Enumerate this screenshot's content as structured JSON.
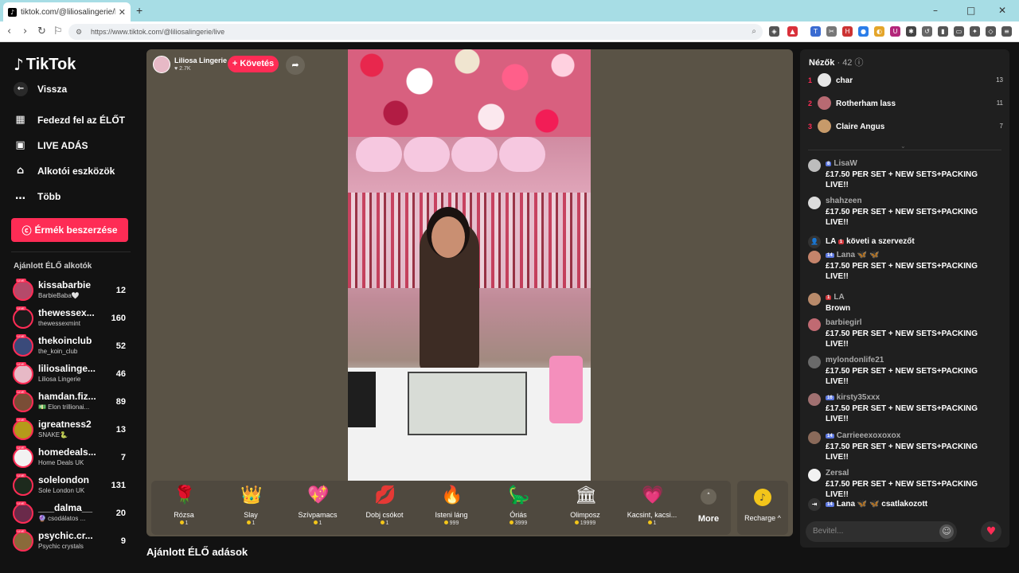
{
  "browser": {
    "tab_title": "tiktok.com/@liliosalingerie/li",
    "url": "https://www.tiktok.com/@liliosalingerie/live",
    "new_tab": "+",
    "minimize": "–",
    "maximize": "□",
    "close": "✕"
  },
  "sidebar": {
    "logo": "TikTok",
    "back": "Vissza",
    "menu": [
      {
        "label": "Fedezd fel az ÉLŐT",
        "icon": "calendar-icon"
      },
      {
        "label": "LIVE ADÁS",
        "icon": "camera-icon"
      },
      {
        "label": "Alkotói eszközök",
        "icon": "creator-tools-icon"
      },
      {
        "label": "Több",
        "icon": "more-icon"
      }
    ],
    "coins_button": "Érmék beszerzése",
    "section_title": "Ajánlott ÉLŐ alkotók",
    "creators": [
      {
        "name": "kissabarbie",
        "sub": "BarbieBaba🤍",
        "count": "12",
        "color": "#b54a6a"
      },
      {
        "name": "thewessex...",
        "sub": "thewessexmint",
        "count": "160",
        "color": "#1b1b1b"
      },
      {
        "name": "thekoinclub",
        "sub": "the_koin_club",
        "count": "52",
        "color": "#3a4a7a"
      },
      {
        "name": "liliosalinge...",
        "sub": "Liliosa Lingerie",
        "count": "46",
        "color": "#e7b9c6"
      },
      {
        "name": "hamdan.fiz...",
        "sub": "💵 Elon trillionai...",
        "count": "89",
        "color": "#7a4d36"
      },
      {
        "name": "igreatness2",
        "sub": "SNAKE🐍",
        "count": "13",
        "color": "#b59a1a"
      },
      {
        "name": "homedeals...",
        "sub": "Home Deals UK",
        "count": "7",
        "color": "#f2f2f2"
      },
      {
        "name": "solelondon",
        "sub": "Sole London UK",
        "count": "131",
        "color": "#1d2a1d"
      },
      {
        "name": "___dalma__",
        "sub": "🔮 csodálatos ...",
        "count": "20",
        "color": "#6a2a4a"
      },
      {
        "name": "psychic.cr...",
        "sub": "Psychic crystals",
        "count": "9",
        "color": "#8a6a3a"
      }
    ]
  },
  "player": {
    "host_name": "Liliosa Lingerie",
    "host_likes": "♥ 2.7K",
    "follow_button": "+ Követés",
    "gifts": [
      {
        "name": "Rózsa",
        "price": "1",
        "icon": "🌹"
      },
      {
        "name": "Slay",
        "price": "1",
        "icon": "👑"
      },
      {
        "name": "Szívpamacs",
        "price": "1",
        "icon": "💖"
      },
      {
        "name": "Dobj csókot",
        "price": "1",
        "icon": "💋"
      },
      {
        "name": "Isteni láng",
        "price": "999",
        "icon": "🔥"
      },
      {
        "name": "Óriás",
        "price": "3999",
        "icon": "🦕"
      },
      {
        "name": "Olimposz",
        "price": "19999",
        "icon": "🏛"
      },
      {
        "name": "Kacsint, kacsi...",
        "price": "1",
        "icon": "💗"
      }
    ],
    "more_label": "More",
    "recharge_label": "Recharge ^"
  },
  "recommended_title": "Ajánlott ÉLŐ adások",
  "chat": {
    "viewers_title": "Nézők",
    "viewers_count": "· 42",
    "top_viewers": [
      {
        "rank": "1",
        "name": "char",
        "score": "13",
        "color": "#e6e6e6"
      },
      {
        "rank": "2",
        "name": "Rotherham lass",
        "score": "11",
        "color": "#b86a72"
      },
      {
        "rank": "3",
        "name": "Claire Angus",
        "score": "7",
        "color": "#c79a6a"
      }
    ],
    "messages": [
      {
        "user": "LisaW",
        "badge": "8",
        "badge_color": "blue",
        "text": "£17.50 PER SET + NEW SETS+PACKING LIVE!!",
        "color": "#bdbdbd"
      },
      {
        "user": "shahzeen",
        "badge": "",
        "badge_color": "",
        "text": "£17.50 PER SET + NEW SETS+PACKING LIVE!!",
        "color": "#dcdcdc"
      },
      {
        "user": "Lana 🦋 🦋",
        "badge": "14",
        "badge_color": "blue",
        "text": "£17.50 PER SET + NEW SETS+PACKING LIVE!!",
        "color": "#c5846b"
      },
      {
        "user": "LA",
        "badge": "1",
        "badge_color": "red",
        "text": "Brown",
        "color": "#b88a6a"
      },
      {
        "user": "barbiegirl",
        "badge": "",
        "badge_color": "",
        "text": "£17.50 PER SET + NEW SETS+PACKING LIVE!!",
        "color": "#c06a72"
      },
      {
        "user": "mylondonlife21",
        "badge": "",
        "badge_color": "",
        "text": "£17.50 PER SET + NEW SETS+PACKING LIVE!!",
        "color": "#6a6a6a"
      },
      {
        "user": "kirsty35xxx",
        "badge": "16",
        "badge_color": "blue",
        "text": "£17.50 PER SET + NEW SETS+PACKING LIVE!!",
        "color": "#a07070"
      },
      {
        "user": "Carrieeexoxoxox",
        "badge": "14",
        "badge_color": "blue",
        "text": "£17.50 PER SET + NEW SETS+PACKING LIVE!!",
        "color": "#8a6a5a"
      },
      {
        "user": "Zersal",
        "badge": "",
        "badge_color": "",
        "text": "£17.50 PER SET + NEW SETS+PACKING LIVE!!",
        "color": "#f2f2f2"
      }
    ],
    "follow_event": {
      "user": "LA",
      "badge": "1",
      "text": "követi a szervezőt"
    },
    "join_event": {
      "user": "Lana 🦋 🦋",
      "badge": "14",
      "text": "csatlakozott"
    },
    "input_placeholder": "Bevitel..."
  },
  "colors": {
    "accent": "#fe2c55",
    "player_bg": "#5a5346",
    "page_bg": "#121212"
  }
}
